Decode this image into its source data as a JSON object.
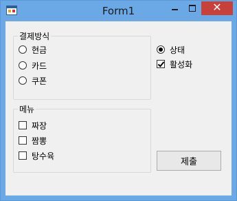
{
  "window": {
    "title": "Form1",
    "close_glyph": "✕"
  },
  "payment": {
    "title": "결제방식",
    "options": [
      {
        "label": "현금",
        "checked": false
      },
      {
        "label": "카드",
        "checked": false
      },
      {
        "label": "쿠폰",
        "checked": false
      }
    ]
  },
  "menu": {
    "title": "메뉴",
    "items": [
      {
        "label": "짜장",
        "checked": false
      },
      {
        "label": "짬뽕",
        "checked": false
      },
      {
        "label": "탕수육",
        "checked": false
      }
    ]
  },
  "status": {
    "label": "상태",
    "checked": true
  },
  "active": {
    "label": "활성화",
    "checked": true
  },
  "submit": {
    "label": "제출"
  },
  "icons": [
    "app-icon",
    "minimize-icon",
    "maximize-icon",
    "close-icon"
  ]
}
